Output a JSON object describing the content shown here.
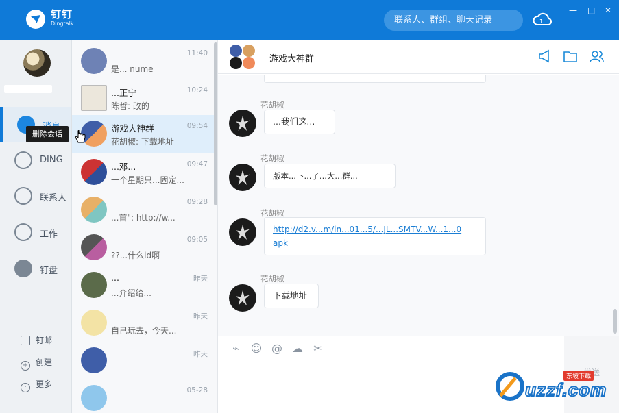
{
  "app": {
    "name_cn": "钉钉",
    "name_en": "Dingtalk"
  },
  "header": {
    "search_placeholder": "联系人、群组、聊天记录"
  },
  "window_controls": [
    "—",
    "□",
    "✕"
  ],
  "nav": {
    "items": [
      {
        "label": "消息",
        "icon": "chat-bubble-icon",
        "active": true
      },
      {
        "label": "DING",
        "icon": "ding-icon",
        "active": false
      },
      {
        "label": "联系人",
        "icon": "contacts-icon",
        "active": false
      },
      {
        "label": "工作",
        "icon": "compass-icon",
        "active": false
      },
      {
        "label": "钉盘",
        "icon": "cloud-disk-icon",
        "active": false
      }
    ],
    "bottom": [
      {
        "label": "钉邮",
        "icon": "mail-icon"
      },
      {
        "label": "创建",
        "icon": "plus-circle-icon"
      },
      {
        "label": "更多",
        "icon": "more-circle-icon"
      }
    ],
    "tooltip": "删除会话"
  },
  "conversations": [
    {
      "name": "",
      "time": "11:40",
      "msg": "是... nume"
    },
    {
      "name": "...正宁",
      "time": "10:24",
      "msg": "陈哲: 改的"
    },
    {
      "name": "游戏大神群",
      "time": "09:54",
      "msg": "花胡椒: 下载地址",
      "selected": true
    },
    {
      "name": "...邓...",
      "time": "09:47",
      "msg": "一个星期只...固定..."
    },
    {
      "name": "",
      "time": "09:28",
      "msg": "...首\": http://w..."
    },
    {
      "name": "",
      "time": "09:05",
      "msg": "??...什么id啊"
    },
    {
      "name": "...",
      "time": "昨天",
      "msg": "...介绍给..."
    },
    {
      "name": "",
      "time": "昨天",
      "msg": "自己玩去，今天..."
    },
    {
      "name": "",
      "time": "昨天",
      "msg": ""
    },
    {
      "name": "",
      "time": "05-28",
      "msg": ""
    }
  ],
  "chat": {
    "title": "游戏大神群",
    "header_icons": [
      "megaphone-icon",
      "folder-icon",
      "group-members-icon"
    ],
    "messages": [
      {
        "sender": "花胡椒",
        "text": "...我们这..."
      },
      {
        "sender": "花胡椒",
        "text": "版本...下...了...大...群..."
      },
      {
        "sender": "花胡椒",
        "text": "http://d2.v...m/in...01...5/...JL...SMTV...W...1...0",
        "text2": "apk",
        "is_link": true
      },
      {
        "sender": "花胡椒",
        "text": "下载地址"
      }
    ],
    "toolbar_icons": [
      "attachment-icon",
      "emoji-icon",
      "mention-icon",
      "cloud-upload-icon",
      "scissors-icon"
    ],
    "toolbar_glyphs": [
      "⌁",
      "☺",
      "@",
      "☁",
      "✂"
    ],
    "send_label": "发送"
  },
  "watermark": {
    "text": "uzzf.com",
    "tag": "东坡下载"
  },
  "colors": {
    "accent": "#0f7ad8",
    "selected_row": "#dfeefb",
    "link": "#1b7ed4"
  }
}
